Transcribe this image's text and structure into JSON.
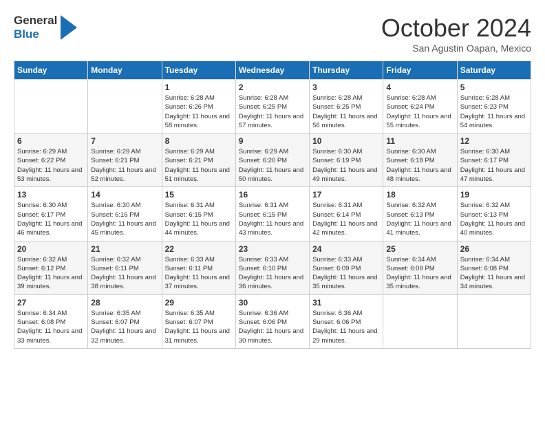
{
  "header": {
    "logo_line1": "General",
    "logo_line2": "Blue",
    "month_title": "October 2024",
    "location": "San Agustin Oapan, Mexico"
  },
  "weekdays": [
    "Sunday",
    "Monday",
    "Tuesday",
    "Wednesday",
    "Thursday",
    "Friday",
    "Saturday"
  ],
  "weeks": [
    [
      {
        "day": "",
        "info": ""
      },
      {
        "day": "",
        "info": ""
      },
      {
        "day": "1",
        "info": "Sunrise: 6:28 AM\nSunset: 6:26 PM\nDaylight: 11 hours and 58 minutes."
      },
      {
        "day": "2",
        "info": "Sunrise: 6:28 AM\nSunset: 6:25 PM\nDaylight: 11 hours and 57 minutes."
      },
      {
        "day": "3",
        "info": "Sunrise: 6:28 AM\nSunset: 6:25 PM\nDaylight: 11 hours and 56 minutes."
      },
      {
        "day": "4",
        "info": "Sunrise: 6:28 AM\nSunset: 6:24 PM\nDaylight: 11 hours and 55 minutes."
      },
      {
        "day": "5",
        "info": "Sunrise: 6:28 AM\nSunset: 6:23 PM\nDaylight: 11 hours and 54 minutes."
      }
    ],
    [
      {
        "day": "6",
        "info": "Sunrise: 6:29 AM\nSunset: 6:22 PM\nDaylight: 11 hours and 53 minutes."
      },
      {
        "day": "7",
        "info": "Sunrise: 6:29 AM\nSunset: 6:21 PM\nDaylight: 11 hours and 52 minutes."
      },
      {
        "day": "8",
        "info": "Sunrise: 6:29 AM\nSunset: 6:21 PM\nDaylight: 11 hours and 51 minutes."
      },
      {
        "day": "9",
        "info": "Sunrise: 6:29 AM\nSunset: 6:20 PM\nDaylight: 11 hours and 50 minutes."
      },
      {
        "day": "10",
        "info": "Sunrise: 6:30 AM\nSunset: 6:19 PM\nDaylight: 11 hours and 49 minutes."
      },
      {
        "day": "11",
        "info": "Sunrise: 6:30 AM\nSunset: 6:18 PM\nDaylight: 11 hours and 48 minutes."
      },
      {
        "day": "12",
        "info": "Sunrise: 6:30 AM\nSunset: 6:17 PM\nDaylight: 11 hours and 47 minutes."
      }
    ],
    [
      {
        "day": "13",
        "info": "Sunrise: 6:30 AM\nSunset: 6:17 PM\nDaylight: 11 hours and 46 minutes."
      },
      {
        "day": "14",
        "info": "Sunrise: 6:30 AM\nSunset: 6:16 PM\nDaylight: 11 hours and 45 minutes."
      },
      {
        "day": "15",
        "info": "Sunrise: 6:31 AM\nSunset: 6:15 PM\nDaylight: 11 hours and 44 minutes."
      },
      {
        "day": "16",
        "info": "Sunrise: 6:31 AM\nSunset: 6:15 PM\nDaylight: 11 hours and 43 minutes."
      },
      {
        "day": "17",
        "info": "Sunrise: 6:31 AM\nSunset: 6:14 PM\nDaylight: 11 hours and 42 minutes."
      },
      {
        "day": "18",
        "info": "Sunrise: 6:32 AM\nSunset: 6:13 PM\nDaylight: 11 hours and 41 minutes."
      },
      {
        "day": "19",
        "info": "Sunrise: 6:32 AM\nSunset: 6:13 PM\nDaylight: 11 hours and 40 minutes."
      }
    ],
    [
      {
        "day": "20",
        "info": "Sunrise: 6:32 AM\nSunset: 6:12 PM\nDaylight: 11 hours and 39 minutes."
      },
      {
        "day": "21",
        "info": "Sunrise: 6:32 AM\nSunset: 6:11 PM\nDaylight: 11 hours and 38 minutes."
      },
      {
        "day": "22",
        "info": "Sunrise: 6:33 AM\nSunset: 6:11 PM\nDaylight: 11 hours and 37 minutes."
      },
      {
        "day": "23",
        "info": "Sunrise: 6:33 AM\nSunset: 6:10 PM\nDaylight: 11 hours and 36 minutes."
      },
      {
        "day": "24",
        "info": "Sunrise: 6:33 AM\nSunset: 6:09 PM\nDaylight: 11 hours and 35 minutes."
      },
      {
        "day": "25",
        "info": "Sunrise: 6:34 AM\nSunset: 6:09 PM\nDaylight: 11 hours and 35 minutes."
      },
      {
        "day": "26",
        "info": "Sunrise: 6:34 AM\nSunset: 6:08 PM\nDaylight: 11 hours and 34 minutes."
      }
    ],
    [
      {
        "day": "27",
        "info": "Sunrise: 6:34 AM\nSunset: 6:08 PM\nDaylight: 11 hours and 33 minutes."
      },
      {
        "day": "28",
        "info": "Sunrise: 6:35 AM\nSunset: 6:07 PM\nDaylight: 11 hours and 32 minutes."
      },
      {
        "day": "29",
        "info": "Sunrise: 6:35 AM\nSunset: 6:07 PM\nDaylight: 11 hours and 31 minutes."
      },
      {
        "day": "30",
        "info": "Sunrise: 6:36 AM\nSunset: 6:06 PM\nDaylight: 11 hours and 30 minutes."
      },
      {
        "day": "31",
        "info": "Sunrise: 6:36 AM\nSunset: 6:06 PM\nDaylight: 11 hours and 29 minutes."
      },
      {
        "day": "",
        "info": ""
      },
      {
        "day": "",
        "info": ""
      }
    ]
  ]
}
